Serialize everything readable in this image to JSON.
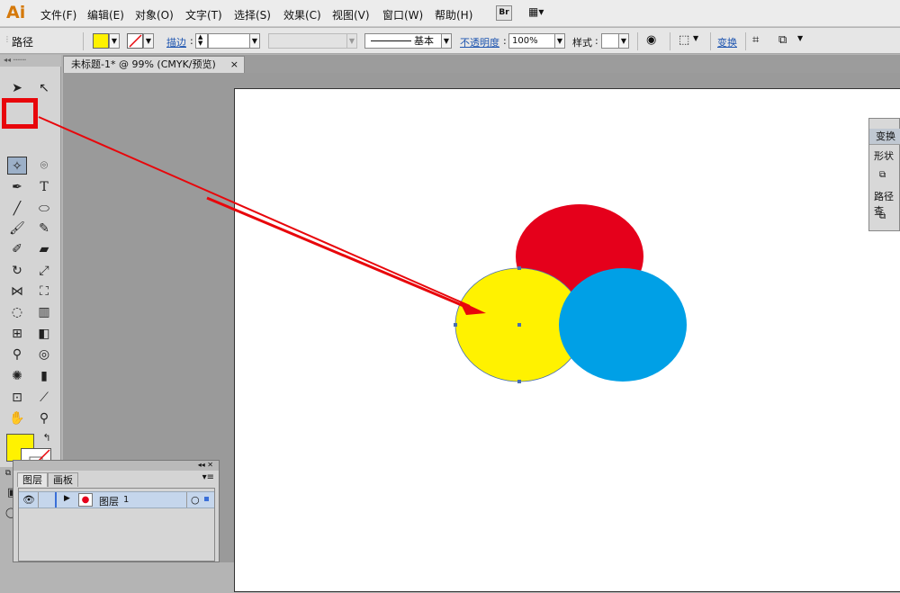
{
  "app": {
    "logo": "Ai"
  },
  "menu": [
    "文件(F)",
    "编辑(E)",
    "对象(O)",
    "文字(T)",
    "选择(S)",
    "效果(C)",
    "视图(V)",
    "窗口(W)",
    "帮助(H)"
  ],
  "menubar_extra": {
    "bridge": "Br",
    "arrange": "▦▾"
  },
  "control": {
    "selection_label": "路径",
    "stroke_label": "描边",
    "stroke_style": "基本",
    "opacity_label": "不透明度",
    "opacity_value": "100%",
    "style_label": "样式",
    "transform_label": "变换"
  },
  "document": {
    "tab_title": "未标题-1* @ 99% (CMYK/预览)",
    "close": "×"
  },
  "layers_panel": {
    "tabs": [
      "图层",
      "画板"
    ],
    "layer_name": "图层",
    "layer_index": "1"
  },
  "right_panel": {
    "tab": "变换",
    "label1": "形状",
    "label2": "路径查"
  },
  "colors": {
    "fill": "#fff200",
    "circle_red": "#e5001b",
    "circle_yellow": "#fff200",
    "circle_blue": "#00a0e6",
    "highlight": "#e8060b",
    "ai_orange": "#d5790a"
  }
}
